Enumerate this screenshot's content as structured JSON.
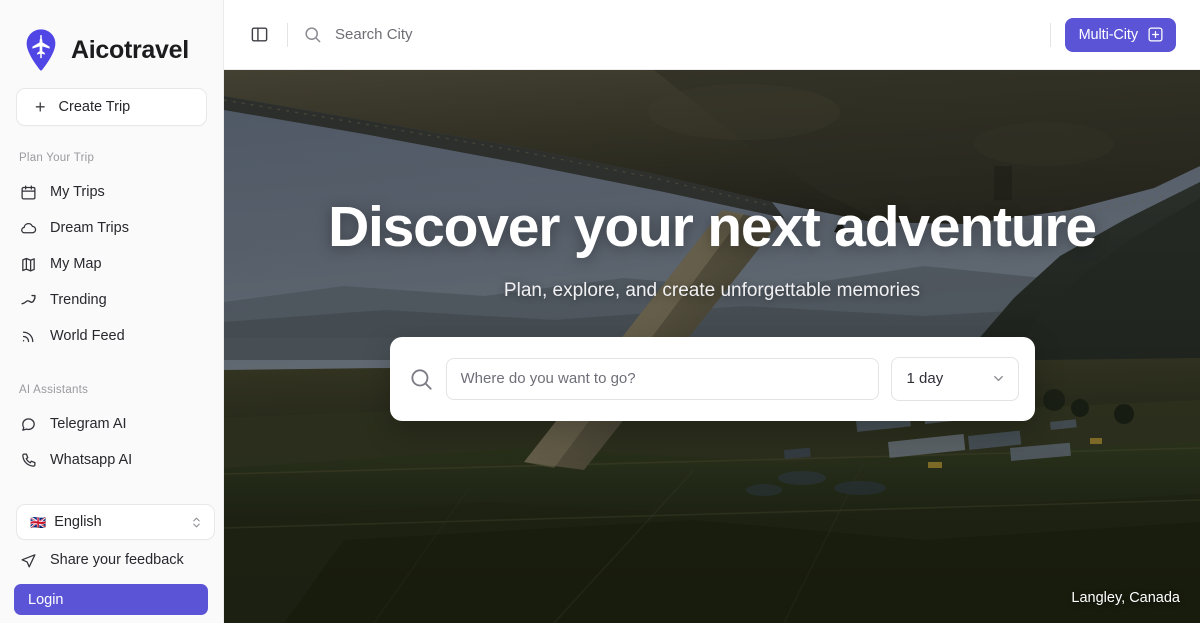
{
  "brand": {
    "name": "Aicotravel",
    "logo_icon": "map-pin-airplane-icon",
    "accent_color": "#5b54d6"
  },
  "sidebar": {
    "create_trip": {
      "label": "Create Trip",
      "icon": "plus-icon"
    },
    "groups": [
      {
        "heading": "Plan Your Trip",
        "items": [
          {
            "label": "My Trips",
            "icon": "calendar-icon"
          },
          {
            "label": "Dream Trips",
            "icon": "cloud-icon"
          },
          {
            "label": "My Map",
            "icon": "map-icon"
          },
          {
            "label": "Trending",
            "icon": "trending-up-icon"
          },
          {
            "label": "World Feed",
            "icon": "rss-icon"
          }
        ]
      },
      {
        "heading": "AI Assistants",
        "items": [
          {
            "label": "Telegram AI",
            "icon": "message-circle-icon"
          },
          {
            "label": "Whatsapp AI",
            "icon": "phone-icon"
          }
        ]
      }
    ],
    "language": {
      "flag": "🇬🇧",
      "label": "English",
      "icon": "chevron-up-down-icon"
    },
    "feedback": {
      "label": "Share your feedback",
      "icon": "send-icon"
    },
    "login": {
      "label": "Login"
    }
  },
  "topbar": {
    "panel_toggle_icon": "panel-left-icon",
    "search": {
      "icon": "search-icon",
      "placeholder": "Search City",
      "value": ""
    },
    "multi_city": {
      "label": "Multi-City",
      "icon": "square-plus-icon"
    }
  },
  "hero": {
    "title": "Discover your next adventure",
    "subtitle": "Plan, explore, and create unforgettable memories",
    "search": {
      "icon": "search-icon",
      "placeholder": "Where do you want to go?",
      "value": ""
    },
    "duration": {
      "value": "1 day",
      "icon": "chevron-down-icon"
    },
    "location_caption": "Langley, Canada",
    "image_description": "Aerial view from a small airplane over green farmland with mountains"
  }
}
